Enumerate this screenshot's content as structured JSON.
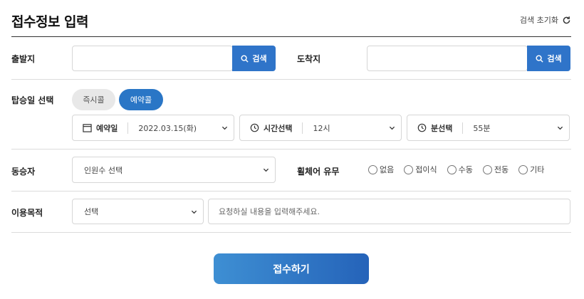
{
  "header": {
    "title": "접수정보 입력",
    "reset_label": "검색 초기화"
  },
  "departure": {
    "label": "출발지",
    "value": "",
    "search_label": "검색"
  },
  "arrival": {
    "label": "도착지",
    "value": "",
    "search_label": "검색"
  },
  "boarding": {
    "label": "탑승일 선택",
    "options": [
      "즉시콜",
      "예약콜"
    ],
    "selected": "예약콜",
    "date": {
      "label": "예약일",
      "value": "2022.03.15(화)"
    },
    "time": {
      "label": "시간선택",
      "value": "12시"
    },
    "minute": {
      "label": "분선택",
      "value": "55분"
    }
  },
  "companion": {
    "label": "동승자",
    "select_value": "인원수 선택"
  },
  "wheelchair": {
    "label": "휠체어 유무",
    "options": [
      "없음",
      "접이식",
      "수동",
      "전동",
      "기타"
    ]
  },
  "purpose": {
    "label": "이용목적",
    "select_value": "선택",
    "request_placeholder": "요청하실 내용을 입력해주세요."
  },
  "submit_label": "접수하기",
  "colors": {
    "accent": "#2f74c9",
    "pill_off": "#e8e8e8"
  }
}
